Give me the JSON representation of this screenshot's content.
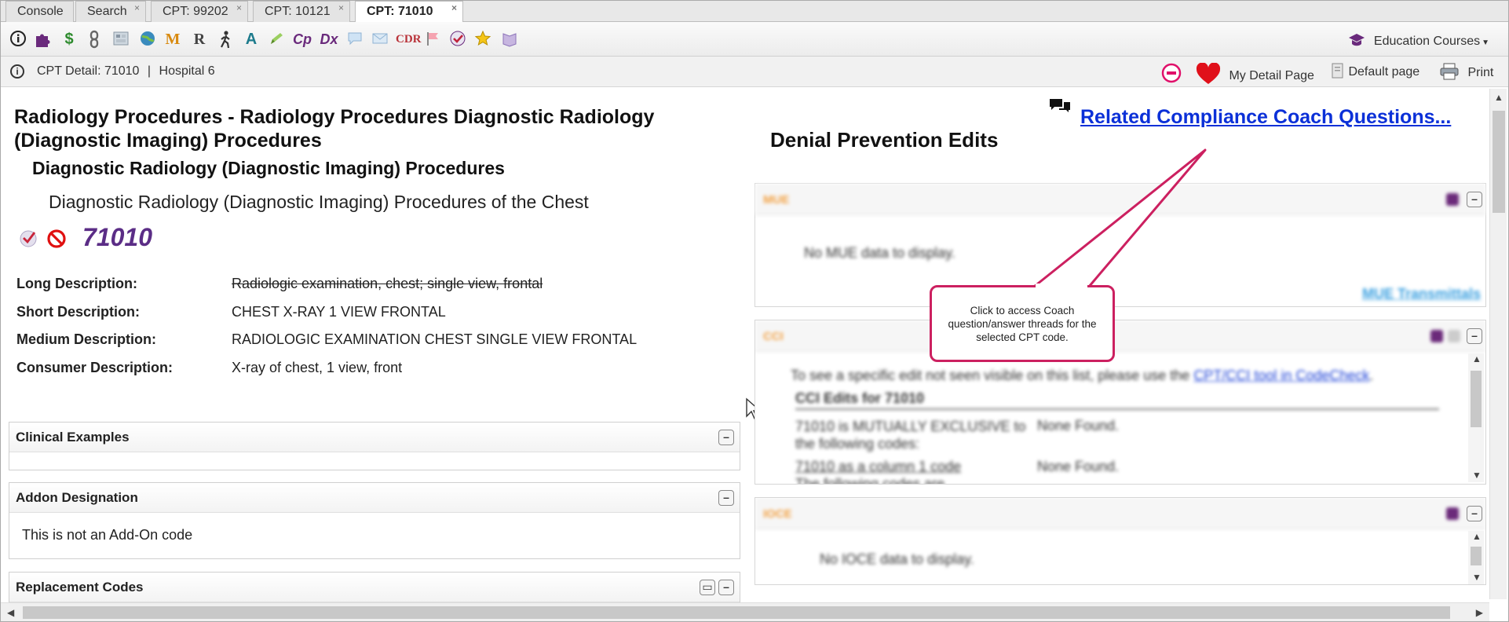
{
  "tabs": [
    {
      "label": "Console"
    },
    {
      "label": "Search",
      "close": "×"
    },
    {
      "label": "CPT: 99202",
      "close": "×"
    },
    {
      "label": "CPT: 10121",
      "close": "×"
    },
    {
      "label": "CPT: 71010",
      "close": "×"
    }
  ],
  "toolbar": {
    "icons": [
      "info-icon",
      "puzzle-icon",
      "dollar-icon",
      "chain-icon",
      "grid-icon",
      "globe-icon",
      "m-icon",
      "r-icon",
      "walker-icon",
      "a-icon",
      "pen-icon",
      "cp-icon",
      "dx-icon",
      "chat-icon",
      "envelope-icon",
      "cdr-icon",
      "flag-icon",
      "check-icon",
      "star-icon",
      "book-icon"
    ],
    "icon_glyphs": {
      "m": "M",
      "r": "R",
      "a": "A",
      "cp": "Cp",
      "dx": "Dx",
      "cdr": "CDR",
      "dollar": "$"
    },
    "education_courses": "Education Courses"
  },
  "infobar": {
    "detail": "CPT Detail: 71010",
    "separator": "|",
    "facility": "Hospital 6",
    "my_detail_page": "My Detail Page",
    "default_page": "Default page",
    "print": "Print"
  },
  "procedure": {
    "title": "Radiology Procedures - Radiology Procedures Diagnostic Radiology (Diagnostic Imaging) Procedures",
    "subtitle": "Diagnostic Radiology (Diagnostic Imaging) Procedures",
    "subsubtitle": "Diagnostic Radiology (Diagnostic Imaging) Procedures of the Chest",
    "code": "71010"
  },
  "descriptions": [
    {
      "label": "Long Description:",
      "value": "Radiologic examination, chest; single view, frontal"
    },
    {
      "label": "Short Description:",
      "value": "CHEST X-RAY 1 VIEW FRONTAL"
    },
    {
      "label": "Medium Description:",
      "value": "RADIOLOGIC EXAMINATION CHEST SINGLE VIEW FRONTAL"
    },
    {
      "label": "Consumer Description:",
      "value": "X-ray of chest, 1 view, front"
    }
  ],
  "panels": {
    "clinical_examples": "Clinical Examples",
    "addon_designation": "Addon Designation",
    "addon_text": "This is not an Add-On code",
    "replacement_codes": "Replacement Codes"
  },
  "right": {
    "title": "Denial Prevention Edits",
    "coach_link": "Related Compliance Coach Questions...",
    "mue": {
      "header": "MUE",
      "text": "No MUE data to display.",
      "link": "MUE Transmittals"
    },
    "cci": {
      "header": "CCI",
      "intro": "To see a specific edit not seen visible on this list, please use the",
      "intro_link": "CPT/CCI tool in CodeCheck",
      "edits_title": "CCI Edits for 71010",
      "row1_label": "71010 is MUTUALLY EXCLUSIVE to the following codes:",
      "row1_value": "None Found.",
      "row2_label": "71010 as a column 1 code",
      "row2_sub": "The following codes are",
      "row2_value": "None Found."
    },
    "ioce": {
      "header": "IOCE",
      "text": "No IOCE data to display."
    }
  },
  "callout": {
    "text": "Click to access Coach question/answer threads for the selected CPT code."
  },
  "colors": {
    "code_purple": "#5b2d86",
    "link_blue": "#0b30d8",
    "callout_border": "#cc2060",
    "heart": "#e0101a"
  }
}
